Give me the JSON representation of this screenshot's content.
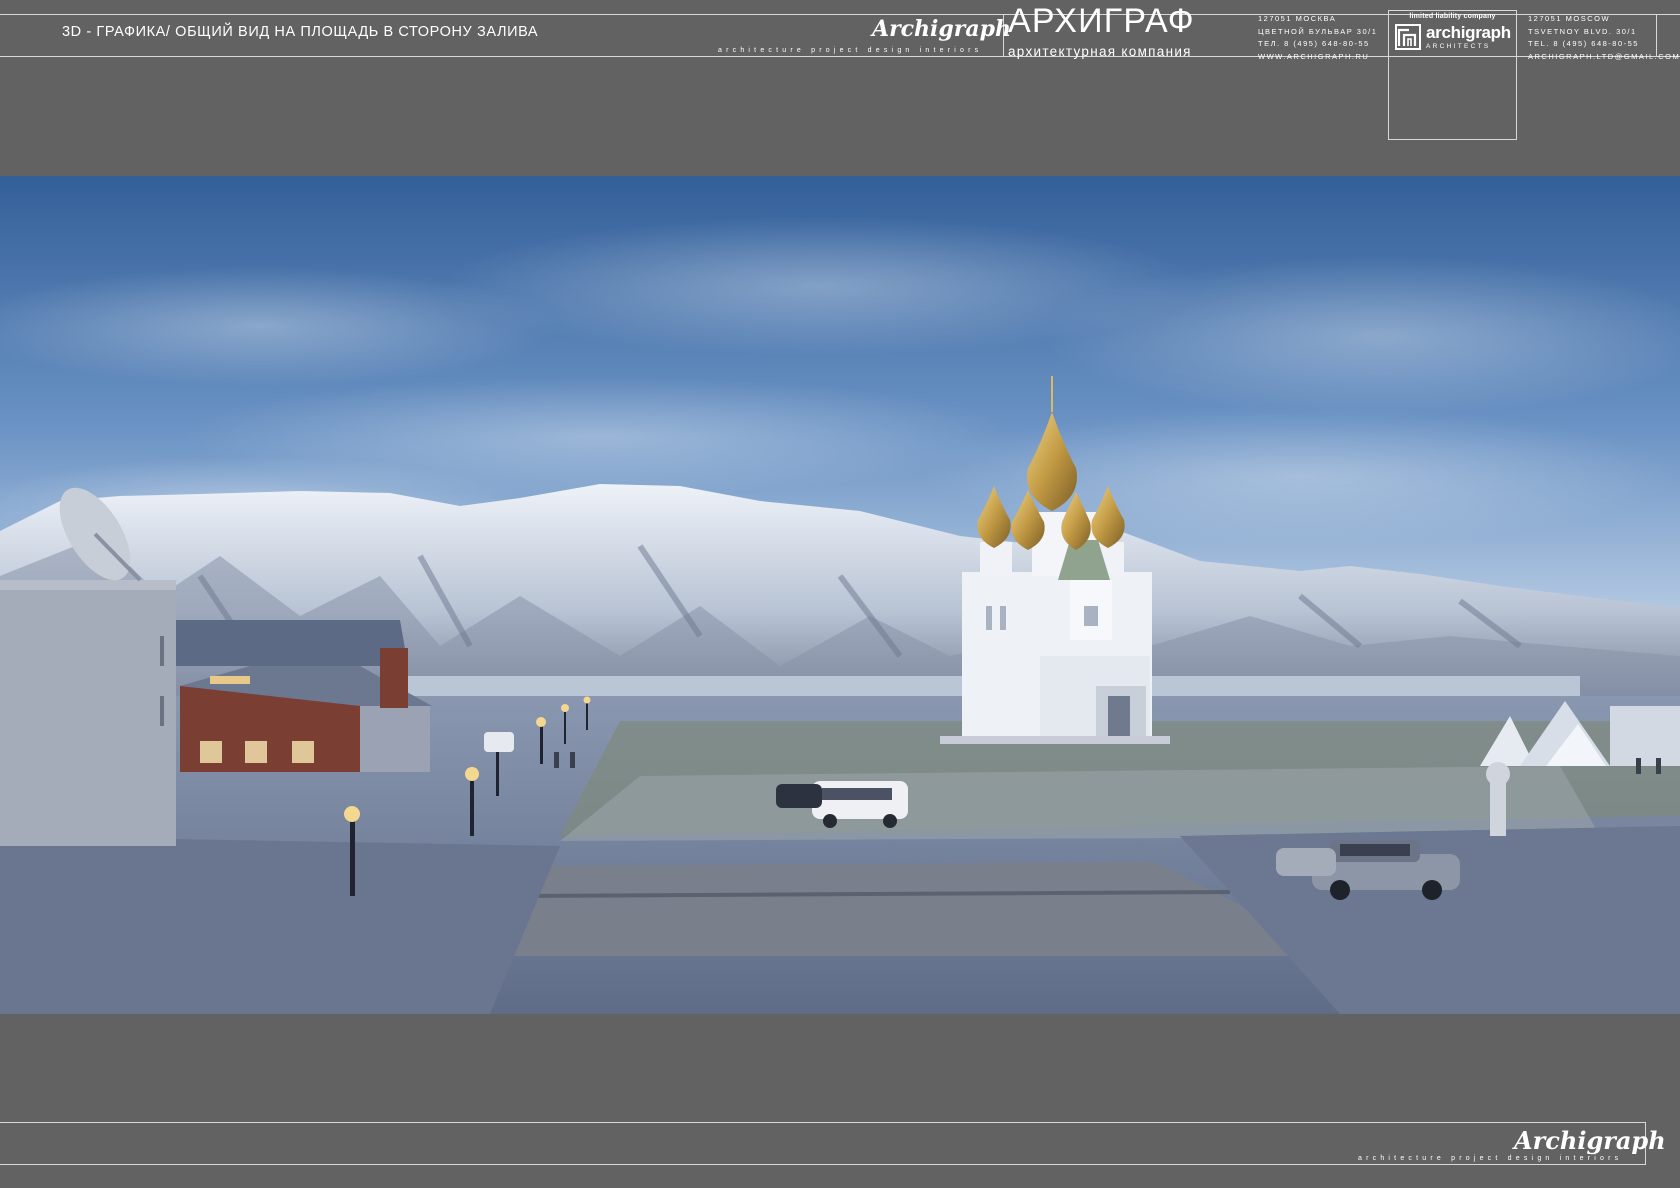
{
  "header": {
    "title": "3D - ГРАФИКА/ ОБЩИЙ ВИД НА ПЛОЩАДЬ В СТОРОНУ ЗАЛИВА",
    "signature": "Archigraph",
    "tagline": "architecture project design interiors",
    "brand_ru": "АРХИГРАФ",
    "brand_sub_ru": "архитектурная компания",
    "address_ru": [
      "127051 МОСКВА",
      "ЦВЕТНОЙ БУЛЬВАР 30/1",
      "ТЕЛ. 8 (495) 648-80-55",
      "WWW.ARCHIGRAPH.RU"
    ],
    "logo": {
      "top": "limited liability company",
      "name": "archigraph",
      "sub": "ARCHITECTS"
    },
    "address_en": [
      "127051 MOSCOW",
      "TSVETNOY BLVD. 30/1",
      "TEL. 8 (495) 648-80-55",
      "ARCHIGRAPH.LTD@GMAIL.COM"
    ]
  },
  "footer": {
    "signature": "Archigraph",
    "tagline": "architecture project design interiors"
  },
  "colors": {
    "background": "#626262",
    "lines": "#d8d8d8",
    "sky": "#3f6fa8",
    "snow": "#e8eef6",
    "dome_gold": "#c9a24a"
  }
}
